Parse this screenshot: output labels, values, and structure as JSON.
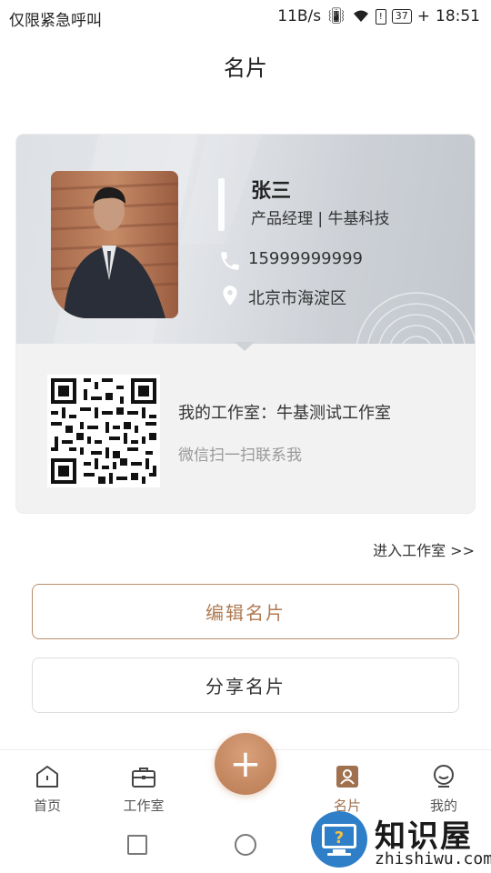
{
  "status_bar": {
    "carrier": "仅限紧急呼叫",
    "speed": "11B/s",
    "battery": "37",
    "time": "18:51"
  },
  "header": {
    "title": "名片"
  },
  "card": {
    "name": "张三",
    "role": "产品经理 | 牛基科技",
    "phone": "15999999999",
    "address": "北京市海淀区",
    "studio": "我的工作室：牛基测试工作室",
    "scan_hint": "微信扫一扫联系我"
  },
  "enter_studio_link": "进入工作室 >>",
  "buttons": {
    "edit": "编辑名片",
    "share": "分享名片"
  },
  "tabs": [
    {
      "label": "首页",
      "icon": "home-icon"
    },
    {
      "label": "工作室",
      "icon": "briefcase-icon"
    },
    {
      "label": "名片",
      "icon": "card-icon",
      "active": true
    },
    {
      "label": "我的",
      "icon": "profile-icon"
    }
  ],
  "watermark": {
    "title": "知识屋",
    "url": "zhishiwu.com"
  },
  "colors": {
    "accent": "#b97a52",
    "active_tab": "#a0714f"
  }
}
